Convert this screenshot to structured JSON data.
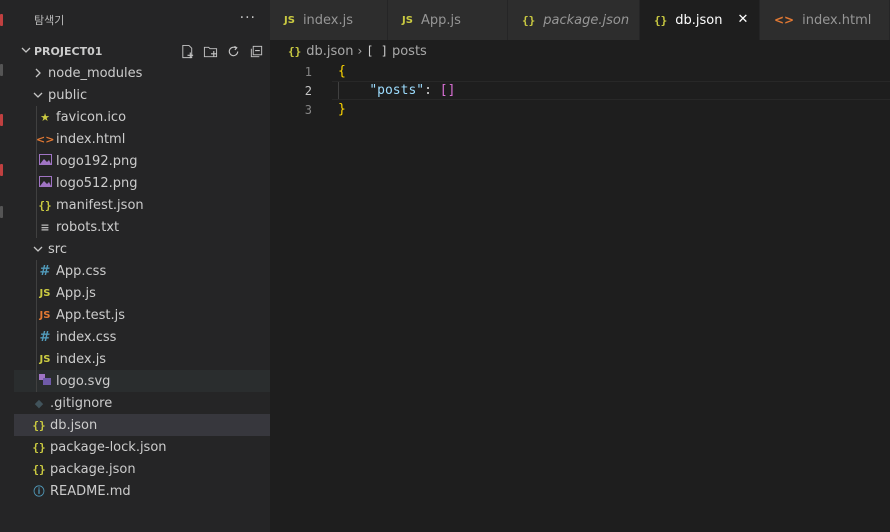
{
  "sidebar": {
    "title": "탐색기",
    "more": "···",
    "project": "PROJECT01",
    "tree": [
      {
        "label": "node_modules",
        "type": "folder",
        "open": false,
        "depth": 1
      },
      {
        "label": "public",
        "type": "folder",
        "open": true,
        "depth": 1
      },
      {
        "label": "favicon.ico",
        "type": "star",
        "depth": 2
      },
      {
        "label": "index.html",
        "type": "html",
        "depth": 2
      },
      {
        "label": "logo192.png",
        "type": "img",
        "depth": 2
      },
      {
        "label": "logo512.png",
        "type": "img",
        "depth": 2
      },
      {
        "label": "manifest.json",
        "type": "json",
        "depth": 2
      },
      {
        "label": "robots.txt",
        "type": "txt",
        "depth": 2
      },
      {
        "label": "src",
        "type": "folder",
        "open": true,
        "depth": 1
      },
      {
        "label": "App.css",
        "type": "css",
        "depth": 2
      },
      {
        "label": "App.js",
        "type": "js",
        "depth": 2
      },
      {
        "label": "App.test.js",
        "type": "jstest",
        "depth": 2
      },
      {
        "label": "index.css",
        "type": "css",
        "depth": 2
      },
      {
        "label": "index.js",
        "type": "js",
        "depth": 2
      },
      {
        "label": "logo.svg",
        "type": "svg",
        "depth": 2,
        "state": "hover"
      },
      {
        "label": ".gitignore",
        "type": "git",
        "depth": 1
      },
      {
        "label": "db.json",
        "type": "json",
        "depth": 1,
        "state": "selected"
      },
      {
        "label": "package-lock.json",
        "type": "json",
        "depth": 1
      },
      {
        "label": "package.json",
        "type": "json",
        "depth": 1
      },
      {
        "label": "README.md",
        "type": "info",
        "depth": 1
      }
    ]
  },
  "tabs": [
    {
      "label": "index.js",
      "icon": "JS",
      "kind": "js",
      "width": 118
    },
    {
      "label": "App.js",
      "icon": "JS",
      "kind": "js",
      "width": 120
    },
    {
      "label": "package.json",
      "icon": "{}",
      "kind": "json",
      "italic": true,
      "width": 132
    },
    {
      "label": "db.json",
      "icon": "{}",
      "kind": "json",
      "active": true,
      "width": 120
    },
    {
      "label": "index.html",
      "icon": "<>",
      "kind": "html",
      "width": 130
    }
  ],
  "close_glyph": "✕",
  "breadcrumb": {
    "icon": "{}",
    "file": "db.json",
    "sep": "›",
    "symbol_icon": "[ ]",
    "symbol": "posts"
  },
  "code": {
    "lines": [
      {
        "n": "1",
        "tokens": [
          {
            "t": "{",
            "c": "brace"
          }
        ]
      },
      {
        "n": "2",
        "current": true,
        "tokens": [
          {
            "t": "    ",
            "c": "punc"
          },
          {
            "t": "\"posts\"",
            "c": "key"
          },
          {
            "t": ": ",
            "c": "punc"
          },
          {
            "t": "[]",
            "c": "bracket"
          }
        ]
      },
      {
        "n": "3",
        "tokens": [
          {
            "t": "}",
            "c": "brace"
          }
        ]
      }
    ]
  }
}
